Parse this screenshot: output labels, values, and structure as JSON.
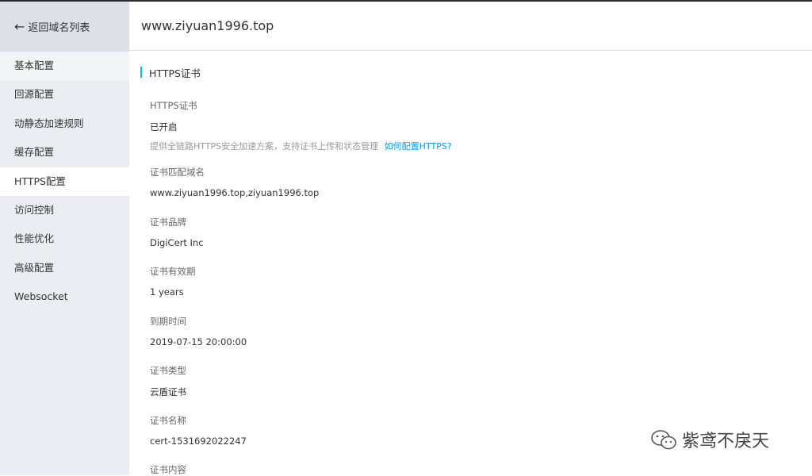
{
  "sidebar": {
    "back_label": "返回域名列表",
    "items": [
      {
        "label": "基本配置"
      },
      {
        "label": "回源配置"
      },
      {
        "label": "动静态加速规则"
      },
      {
        "label": "缓存配置"
      },
      {
        "label": "HTTPS配置"
      },
      {
        "label": "访问控制"
      },
      {
        "label": "性能优化"
      },
      {
        "label": "高级配置"
      },
      {
        "label": "Websocket"
      }
    ]
  },
  "header": {
    "title": "www.ziyuan1996.top"
  },
  "section": {
    "title": "HTTPS证书"
  },
  "fields": {
    "https_cert": {
      "label": "HTTPS证书",
      "value": "已开启",
      "hint": "提供全链路HTTPS安全加速方案，支持证书上传和状态管理",
      "link": "如何配置HTTPS?"
    },
    "domain": {
      "label": "证书匹配域名",
      "value": "www.ziyuan1996.top,ziyuan1996.top"
    },
    "brand": {
      "label": "证书品牌",
      "value": "DigiCert Inc"
    },
    "validity": {
      "label": "证书有效期",
      "value": "1 years"
    },
    "expire": {
      "label": "到期时间",
      "value": "2019-07-15 20:00:00"
    },
    "type": {
      "label": "证书类型",
      "value": "云盾证书"
    },
    "name": {
      "label": "证书名称",
      "value": "cert-1531692022247"
    },
    "content": {
      "label": "证书内容"
    }
  },
  "watermark": {
    "text": "紫鸢不戾天"
  }
}
